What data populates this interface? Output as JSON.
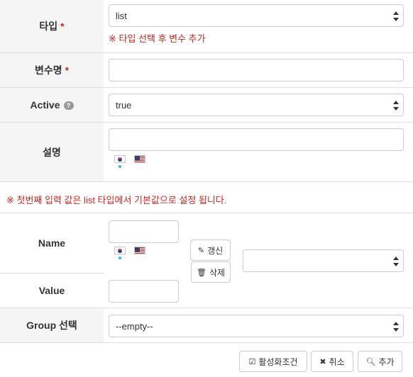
{
  "required_mark": "*",
  "type_row": {
    "label": "타입",
    "selected": "list",
    "note": "※ 타입 선택 후 변수 추가"
  },
  "varname_row": {
    "label": "변수명",
    "value": ""
  },
  "active_row": {
    "label": "Active",
    "selected": "true",
    "help_icon": "question-circle"
  },
  "desc_row": {
    "label": "설명",
    "value": ""
  },
  "list_note": "※ 첫번째 입력 값은 list 타입에서 기본값으로 설정 됩니다.",
  "name_row": {
    "label": "Name",
    "value": ""
  },
  "value_row": {
    "label": "Value",
    "value": ""
  },
  "list_buttons": {
    "update": "갱신",
    "delete": "삭제"
  },
  "list_select": {
    "selected": ""
  },
  "group_row": {
    "label": "Group 선택",
    "selected": "--empty--"
  },
  "footer": {
    "activate_condition": "활성화조건",
    "cancel": "취소",
    "add": "추가"
  },
  "languages": [
    "ko",
    "en"
  ],
  "colors": {
    "required": "#d9241b",
    "label_bg": "#f5f5f5",
    "active_lang_dot": "#3bb3ff"
  }
}
